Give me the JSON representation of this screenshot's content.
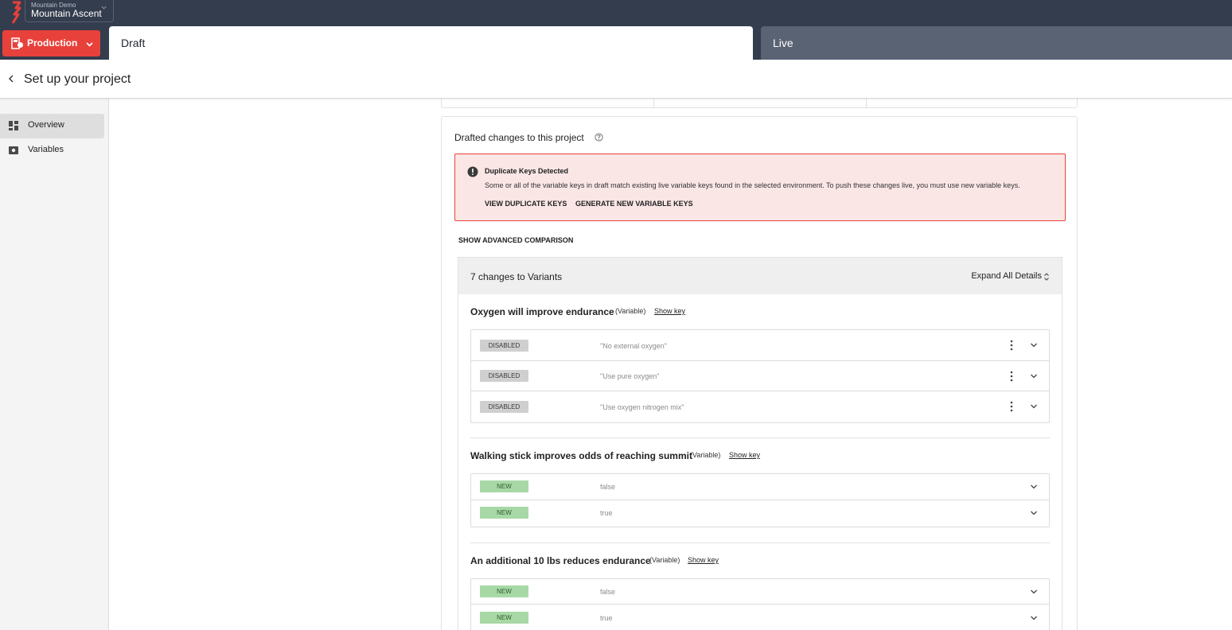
{
  "app": {
    "org_name": "Mountain Demo",
    "project_name": "Mountain Ascent",
    "environment": "Production",
    "tabs": [
      "Draft",
      "Live"
    ]
  },
  "header": {
    "title": "Set up your project"
  },
  "sidebar": {
    "items": [
      {
        "label": "Overview",
        "icon": "dashboard-icon",
        "active": true
      },
      {
        "label": "Variables",
        "icon": "variables-icon",
        "active": false
      }
    ]
  },
  "main": {
    "section_title": "Drafted changes to this project",
    "alert": {
      "title": "Duplicate Keys Detected",
      "message": "Some or all of the variable keys in draft match existing live variable keys found in the selected environment. To push these changes live, you must use new variable keys.",
      "action_view": "VIEW DUPLICATE KEYS",
      "action_generate": "GENERATE NEW VARIABLE KEYS"
    },
    "advanced_link": "SHOW ADVANCED COMPARISON",
    "changes": {
      "title": "7 changes to Variants",
      "expand_label": "Expand All Details",
      "variables": [
        {
          "name": "Oxygen will improve endurance",
          "tag": "(Variable)",
          "show_key": "Show key",
          "rows": [
            {
              "status": "DISABLED",
              "value": "\"No external oxygen\""
            },
            {
              "status": "DISABLED",
              "value": "\"Use pure oxygen\""
            },
            {
              "status": "DISABLED",
              "value": "\"Use oxygen nitrogen mix\""
            }
          ]
        },
        {
          "name": "Walking stick improves odds of reaching summit",
          "tag": "(Variable)",
          "show_key": "Show key",
          "rows": [
            {
              "status": "NEW",
              "value": "false"
            },
            {
              "status": "NEW",
              "value": "true"
            }
          ]
        },
        {
          "name": "An additional 10 lbs reduces endurance",
          "tag": "(Variable)",
          "show_key": "Show key",
          "rows": [
            {
              "status": "NEW",
              "value": "false"
            },
            {
              "status": "NEW",
              "value": "true"
            }
          ]
        }
      ]
    }
  },
  "colors": {
    "topbar": "#343d4d",
    "accent": "#e8413b",
    "badge_disabled": "#cfcfcf",
    "badge_new": "#a8d8a5"
  }
}
